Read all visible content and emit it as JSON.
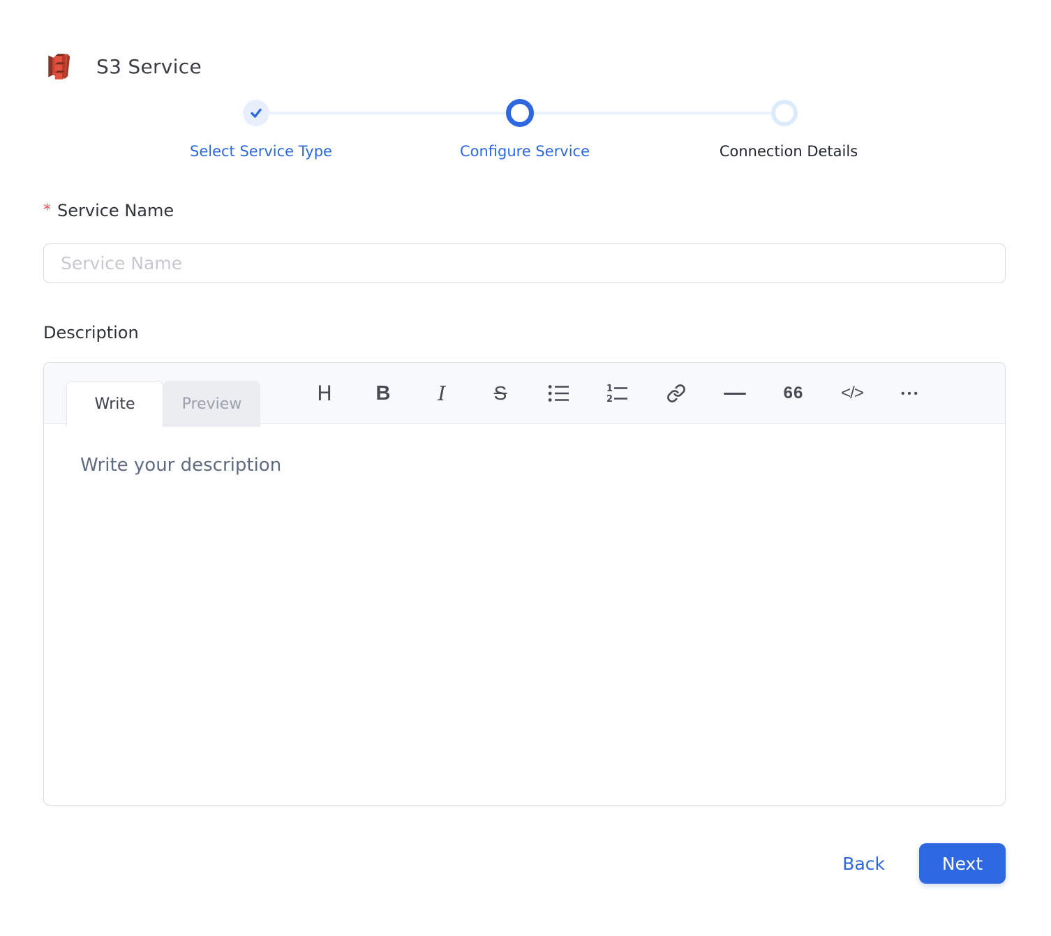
{
  "header": {
    "title": "S3 Service",
    "icon": "s3-service-logo"
  },
  "stepper": {
    "steps": [
      {
        "label": "Select Service Type",
        "state": "completed"
      },
      {
        "label": "Configure Service",
        "state": "active"
      },
      {
        "label": "Connection Details",
        "state": "upcoming"
      }
    ]
  },
  "form": {
    "service_name": {
      "label": "Service Name",
      "required_marker": "*",
      "value": "",
      "placeholder": "Service Name"
    },
    "description": {
      "label": "Description",
      "value": "",
      "placeholder": "Write your description",
      "editor": {
        "tabs": [
          {
            "label": "Write",
            "active": true
          },
          {
            "label": "Preview",
            "active": false
          }
        ],
        "toolbar": [
          {
            "name": "heading",
            "glyph": "H"
          },
          {
            "name": "bold",
            "glyph": "B"
          },
          {
            "name": "italic",
            "glyph": "I"
          },
          {
            "name": "strikethrough",
            "glyph": "S"
          },
          {
            "name": "bulleted-list"
          },
          {
            "name": "numbered-list"
          },
          {
            "name": "link"
          },
          {
            "name": "horizontal-rule"
          },
          {
            "name": "quote",
            "glyph": "66"
          },
          {
            "name": "code",
            "glyph": "</>"
          },
          {
            "name": "more",
            "glyph": "•••"
          }
        ]
      }
    }
  },
  "footer": {
    "back_label": "Back",
    "next_label": "Next"
  },
  "colors": {
    "primary_blue": "#2d68e0",
    "step_completed_bg": "#e7effd",
    "step_upcoming_ring": "#dcebfb",
    "connector_line": "#e9f1fc",
    "required_red": "#f14e4e",
    "s3_red_dark": "#8c3123",
    "s3_red_bright": "#e05243",
    "input_border": "#d9dbdf",
    "toolbar_bg": "#f8f9fb",
    "preview_tab_bg": "#ebedf0"
  }
}
